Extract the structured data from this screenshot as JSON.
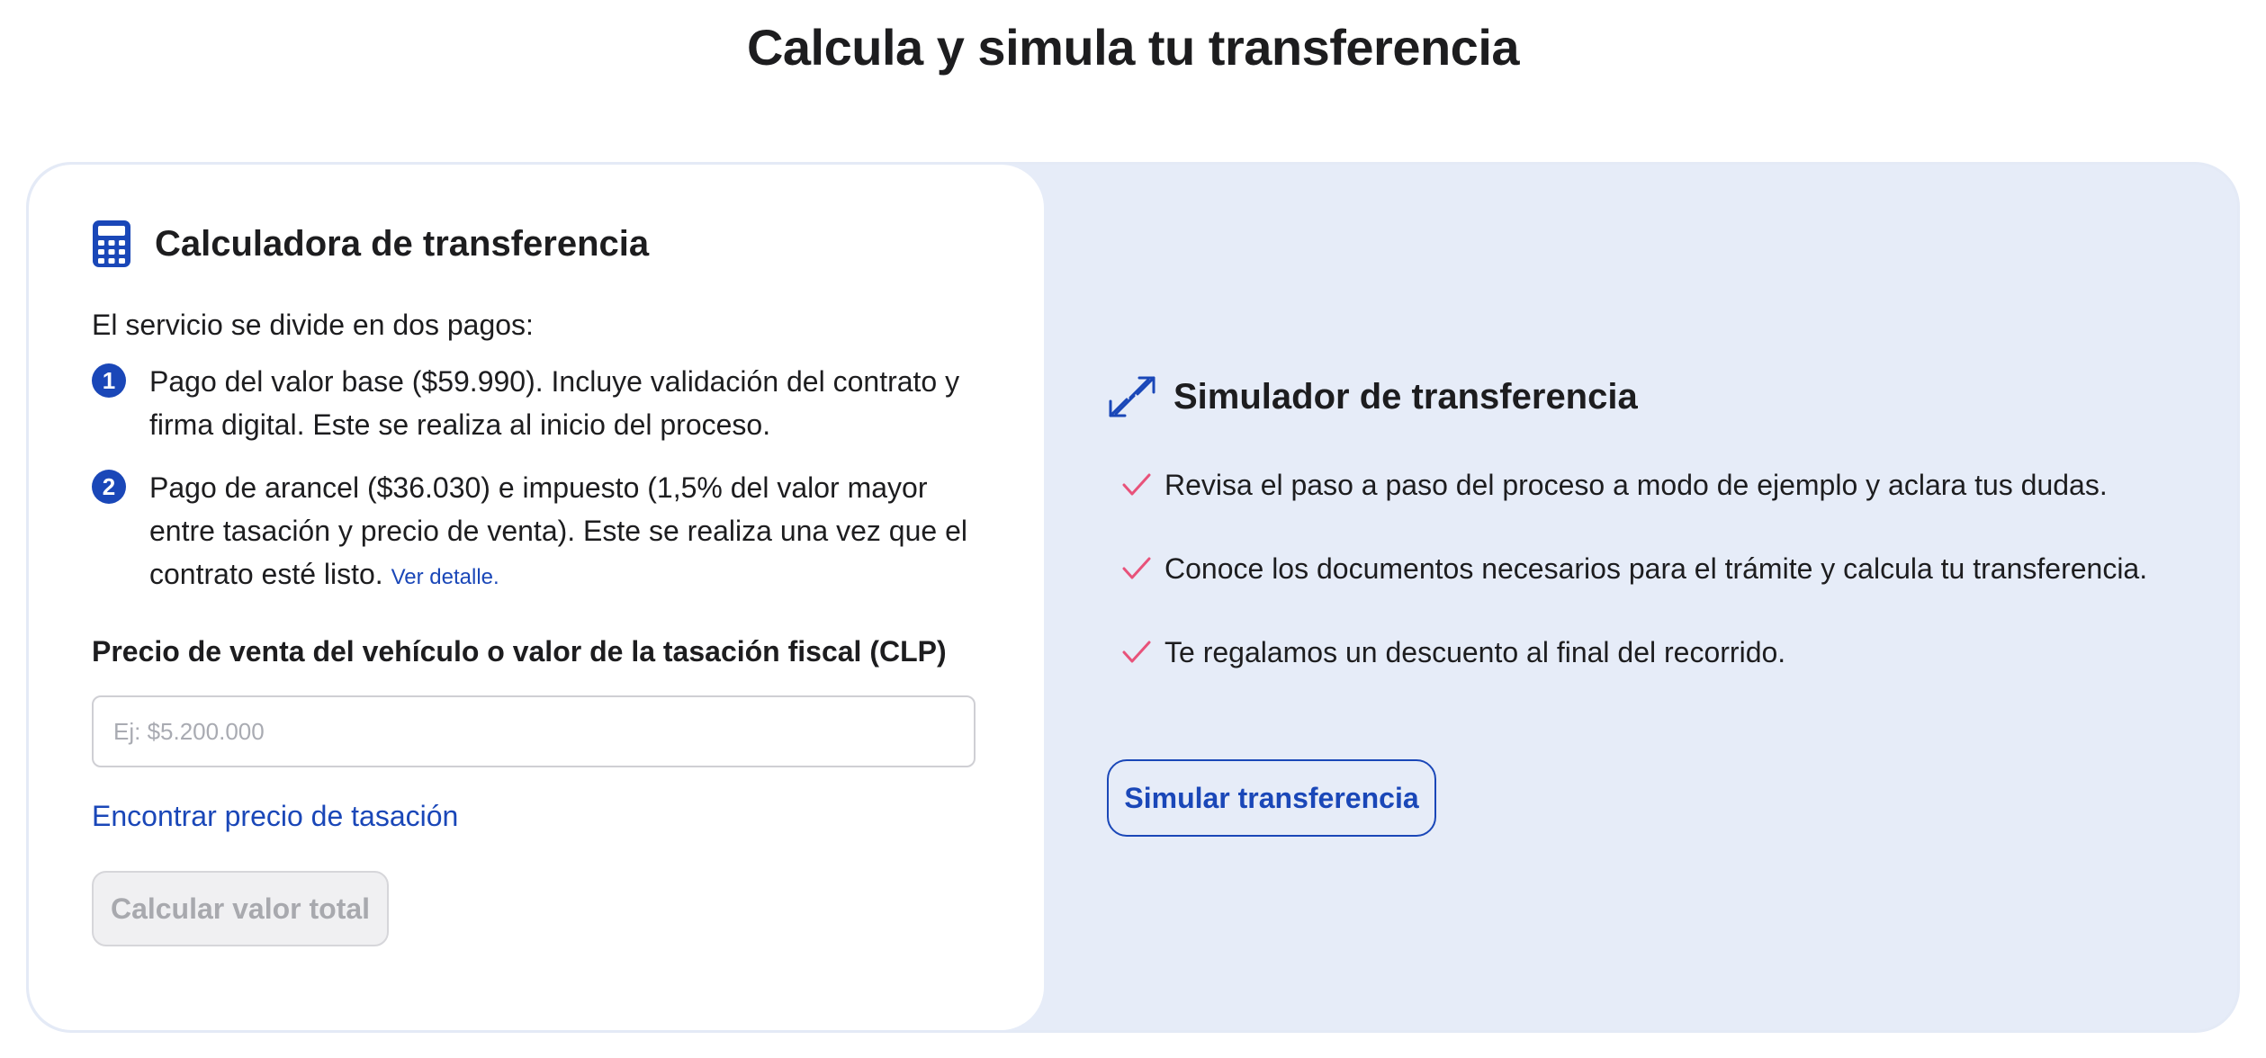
{
  "page": {
    "title": "Calcula y simula tu transferencia"
  },
  "calculator": {
    "title": "Calculadora de transferencia",
    "intro": "El servicio se divide en dos pagos:",
    "steps": [
      {
        "number": "1",
        "text": "Pago del valor base ($59.990). Incluye validación del contrato y firma digital. Este se realiza al inicio del proceso."
      },
      {
        "number": "2",
        "text": "Pago de arancel ($36.030) e impuesto (1,5% del valor mayor entre tasación y precio de venta). Este se realiza una vez que el contrato esté listo.",
        "link": "Ver detalle."
      }
    ],
    "field_label": "Precio de venta del vehículo o valor de la tasación fiscal (CLP)",
    "input_placeholder": "Ej: $5.200.000",
    "input_value": "",
    "tasacion_link": "Encontrar precio de tasación",
    "calc_button": "Calcular valor total",
    "icon": "calculator-icon"
  },
  "simulator": {
    "title": "Simulador de transferencia",
    "icon": "transfer-arrows-icon",
    "benefits": [
      "Revisa el paso a paso del proceso a modo de ejemplo y aclara tus dudas.",
      "Conoce los documentos necesarios para el trámite y calcula tu transferencia.",
      "Te regalamos un descuento al final del recorrido."
    ],
    "button": "Simular transferencia"
  },
  "colors": {
    "accent": "#1a47b8",
    "panel_bg": "#e6ecf8",
    "check": "#e8527a",
    "disabled_text": "#a8a9ae"
  }
}
